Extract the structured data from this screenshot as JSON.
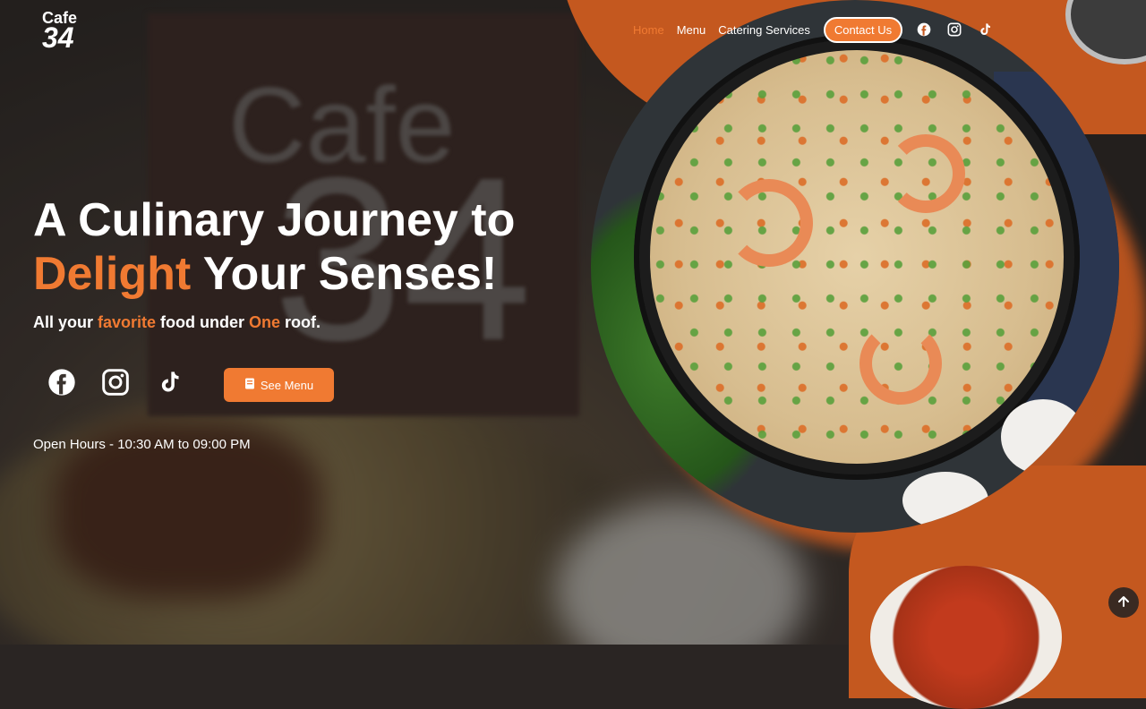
{
  "brand": {
    "logo_line1": "Cafe",
    "logo_line2": "34",
    "background_watermark_line1": "Cafe",
    "background_watermark_line2": "34"
  },
  "nav": {
    "items": [
      {
        "label": "Home",
        "active": true
      },
      {
        "label": "Menu",
        "active": false
      },
      {
        "label": "Catering Services",
        "active": false
      }
    ],
    "contact_label": "Contact Us",
    "icons": [
      "facebook-icon",
      "instagram-icon",
      "tiktok-icon"
    ]
  },
  "hero": {
    "title_line1": "A Culinary Journey to",
    "title_accent": "Delight",
    "title_rest": " Your Senses!",
    "sub_part1": "All your ",
    "sub_accent1": "favorite",
    "sub_part2": " food under ",
    "sub_accent2": "One",
    "sub_part3": " roof.",
    "see_menu_label": "See Menu",
    "open_hours": "Open Hours - 10:30 AM to 09:00 PM"
  },
  "colors": {
    "accent": "#f07a32",
    "orange_shape": "#c4581f",
    "background_dark": "#2a2523"
  },
  "scroll_top_icon": "arrow-up-icon"
}
